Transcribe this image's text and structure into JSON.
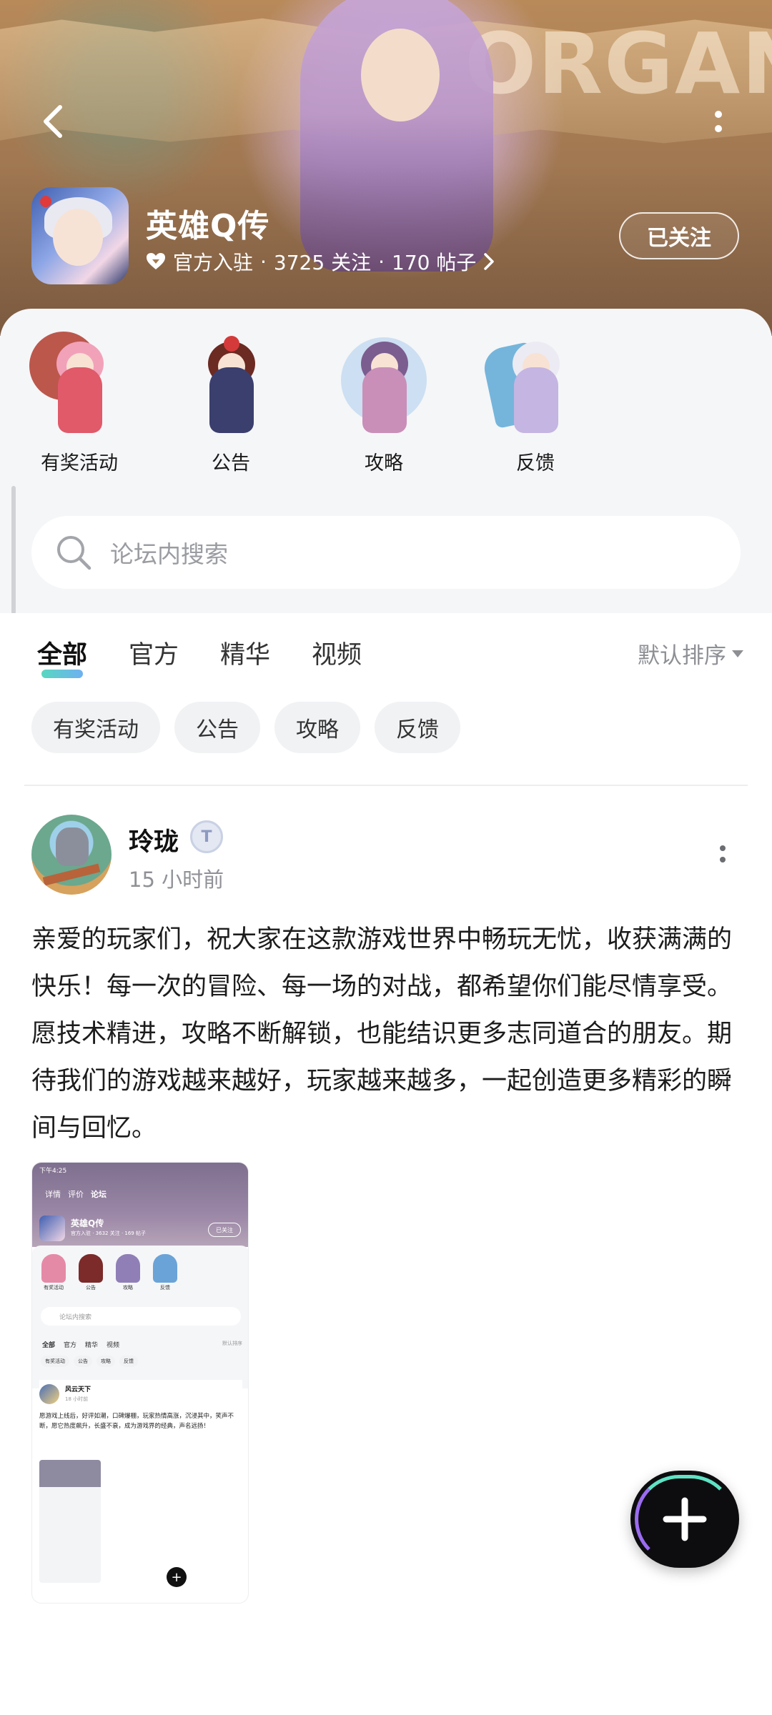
{
  "header": {
    "banner_word": "ORGAN",
    "game_title": "英雄Q传",
    "meta": {
      "verified_label": "官方入驻",
      "followers": "3725 关注",
      "posts": "170 帖子"
    },
    "follow_label": "已关注",
    "icons": {
      "back": "back-chevron-icon",
      "more": "more-vertical-icon",
      "verified": "heart-badge-icon",
      "arrow": "chevron-right-icon"
    }
  },
  "shortcuts": [
    {
      "label": "有奖活动",
      "color": "#e58aa6"
    },
    {
      "label": "公告",
      "color": "#7c2a2a"
    },
    {
      "label": "攻略",
      "color": "#8f7fb6"
    },
    {
      "label": "反馈",
      "color": "#6aa3d8"
    }
  ],
  "search": {
    "placeholder": "论坛内搜索",
    "icon": "search-icon"
  },
  "feed": {
    "tabs": [
      {
        "label": "全部",
        "active": true
      },
      {
        "label": "官方",
        "active": false
      },
      {
        "label": "精华",
        "active": false
      },
      {
        "label": "视频",
        "active": false
      }
    ],
    "sort_label": "默认排序",
    "chips": [
      "有奖活动",
      "公告",
      "攻略",
      "反馈"
    ]
  },
  "post": {
    "author": "玲珑",
    "badge": "T",
    "time": "15 小时前",
    "text": "亲爱的玩家们，祝大家在这款游戏世界中畅玩无忧，收获满满的快乐！每一次的冒险、每一场的对战，都希望你们能尽情享受。愿技术精进，攻略不断解锁，也能结识更多志同道合的朋友。期待我们的游戏越来越好，玩家越来越多，一起创造更多精彩的瞬间与回忆。",
    "image": {
      "status": "下午4:25",
      "nav": [
        "详情",
        "评价",
        "论坛"
      ],
      "title": "英雄Q传",
      "meta": "官方入驻 · 3632 关注 · 169 帖子",
      "follow": "已关注",
      "shortcuts": [
        "有奖活动",
        "公告",
        "攻略",
        "反馈"
      ],
      "search": "论坛内搜索",
      "tabs": [
        "全部",
        "官方",
        "精华",
        "视频"
      ],
      "sort": "默认排序",
      "chips": [
        "有奖活动",
        "公告",
        "攻略",
        "反馈"
      ],
      "post_author": "风云天下",
      "post_time": "18 小时前",
      "post_text": "愿游戏上线后，好评如潮，口碑爆棚，玩家热情高涨，沉浸其中，笑声不断，愿它热度飙升，长盛不衰，成为游戏界的经典，声名远扬！"
    }
  },
  "fab": {
    "icon": "plus-icon"
  },
  "colors": {
    "accent_gradient_start": "#45d3b8",
    "accent_gradient_end": "#5ea8f0",
    "sheet_bg": "#f5f6f8"
  }
}
